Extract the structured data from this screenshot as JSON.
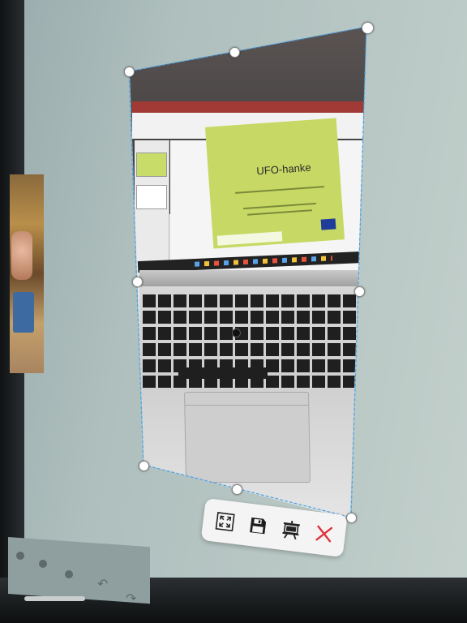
{
  "photo": {
    "slide_title": "UFO-hanke"
  },
  "toolbar": {
    "buttons": [
      {
        "icon": "fullscreen-icon"
      },
      {
        "icon": "save-icon"
      },
      {
        "icon": "presentation-board-icon"
      },
      {
        "icon": "close-icon"
      }
    ]
  },
  "colors": {
    "selection_outline": "#4aa3e8",
    "close_accent": "#e0333a",
    "slide_green": "#c7d964",
    "ribbon_red": "#a13a34"
  }
}
